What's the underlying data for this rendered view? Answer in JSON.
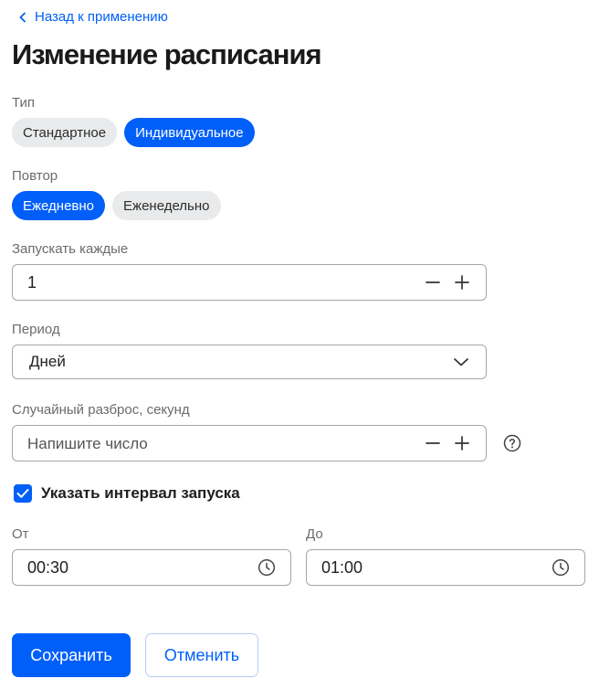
{
  "nav": {
    "back_label": "Назад к применению"
  },
  "page": {
    "title": "Изменение расписания"
  },
  "type_group": {
    "label": "Тип",
    "options": [
      {
        "label": "Стандартное",
        "selected": false
      },
      {
        "label": "Индивидуальное",
        "selected": true
      }
    ]
  },
  "repeat_group": {
    "label": "Повтор",
    "options": [
      {
        "label": "Ежедневно",
        "selected": true
      },
      {
        "label": "Еженедельно",
        "selected": false
      }
    ]
  },
  "run_every": {
    "label": "Запускать каждые",
    "value": "1"
  },
  "period": {
    "label": "Период",
    "value": "Дней"
  },
  "random_spread": {
    "label": "Случайный разброс, секунд",
    "value": "",
    "placeholder": "Напишите число"
  },
  "interval": {
    "checkbox_label": "Указать интервал запуска",
    "checked": true,
    "from_label": "От",
    "from_value": "00:30",
    "to_label": "До",
    "to_value": "01:00"
  },
  "actions": {
    "save_label": "Сохранить",
    "cancel_label": "Отменить"
  },
  "colors": {
    "accent": "#005ff9",
    "pill_off": "#e9eaeb",
    "border": "#a6a6a6"
  }
}
